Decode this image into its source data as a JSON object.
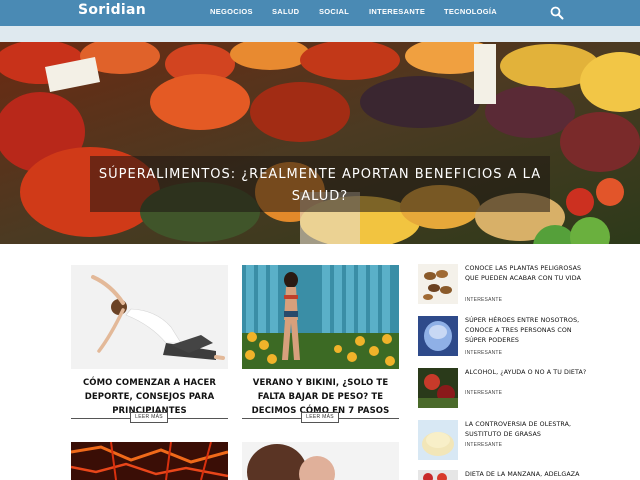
{
  "header": {
    "logo": "Soridian",
    "nav": [
      "NEGOCIOS",
      "SALUD",
      "SOCIAL",
      "INTERESANTE",
      "TECNOLOGÍA"
    ],
    "search_icon": "search-icon",
    "colors": {
      "bar": "#4a8ab4",
      "subbar": "#dfe9ef"
    }
  },
  "hero": {
    "title": "Súperalimentos: ¿Realmente aportan beneficios a la salud?"
  },
  "cards": [
    {
      "title": "Cómo comenzar a hacer deporte, consejos para principiantes",
      "button": "LEER MÁS"
    },
    {
      "title": "Verano y bikini, ¿solo te falta bajar de peso? Te decimos cómo en 7 pasos",
      "button": "LEER MÁS"
    }
  ],
  "sidebar": [
    {
      "title": "Conoce las plantas peligrosas que pueden acabar con tu vida",
      "tag": "INTERESANTE"
    },
    {
      "title": "Súper héroes entre nosotros, conoce a tres personas con súper poderes",
      "tag": "INTERESANTE"
    },
    {
      "title": "Alcohol, ¿ayuda o no a tu dieta?",
      "tag": "INTERESANTE"
    },
    {
      "title": "La controversia de Olestra, sustituto de grasas",
      "tag": "INTERESANTE"
    },
    {
      "title": "Dieta de la manzana, adelgaza",
      "tag": ""
    }
  ]
}
